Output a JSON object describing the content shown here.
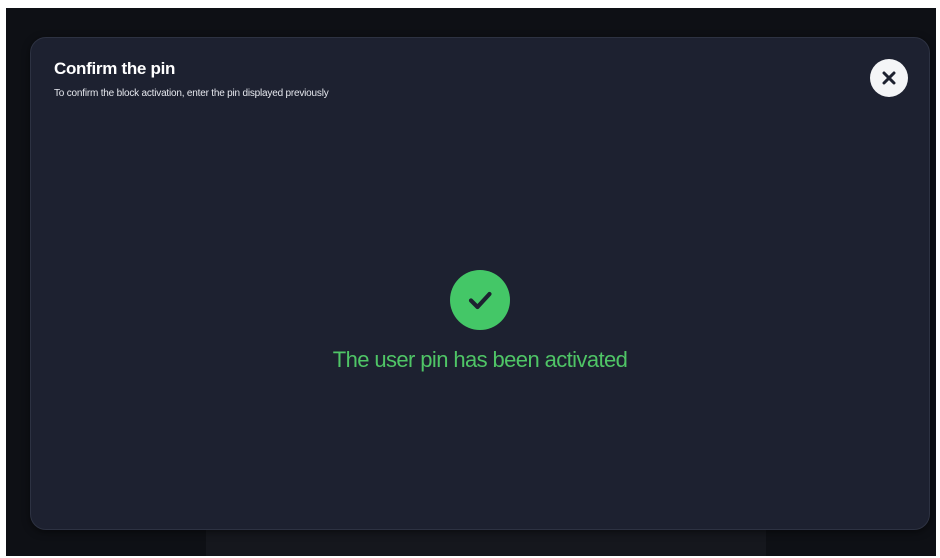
{
  "dialog": {
    "title": "Confirm the pin",
    "subtitle": "To confirm the block activation, enter the pin displayed previously",
    "close_icon": "close-icon"
  },
  "status": {
    "icon": "check-circle-icon",
    "message": "The user pin has been activated",
    "color": "#4fc566"
  },
  "colors": {
    "modal_background": "#1d2130",
    "screen_background": "#0e1015",
    "success_accent": "#44c767",
    "close_button_background": "#f4f5f7"
  }
}
